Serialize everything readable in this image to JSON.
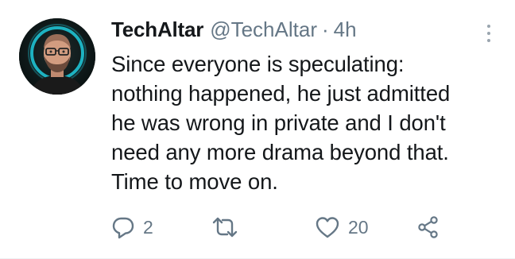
{
  "tweet": {
    "display_name": "TechAltar",
    "handle": "@TechAltar",
    "separator": "·",
    "time": "4h",
    "text": "Since everyone is speculating:\nnothing happened, he just admitted\nhe was wrong in private and I don't\nneed any more drama beyond that.\nTime to move on.",
    "avatar_icon": "avatar-photo",
    "more_icon": "more-vertical-icon"
  },
  "actions": {
    "reply": {
      "icon": "reply-icon",
      "count": "2"
    },
    "retweet": {
      "icon": "retweet-icon",
      "count": ""
    },
    "like": {
      "icon": "heart-icon",
      "count": "20"
    },
    "share": {
      "icon": "share-icon"
    }
  },
  "colors": {
    "text_primary": "#14171a",
    "text_secondary": "#657786",
    "avatar_glow": "#22c6d6"
  }
}
